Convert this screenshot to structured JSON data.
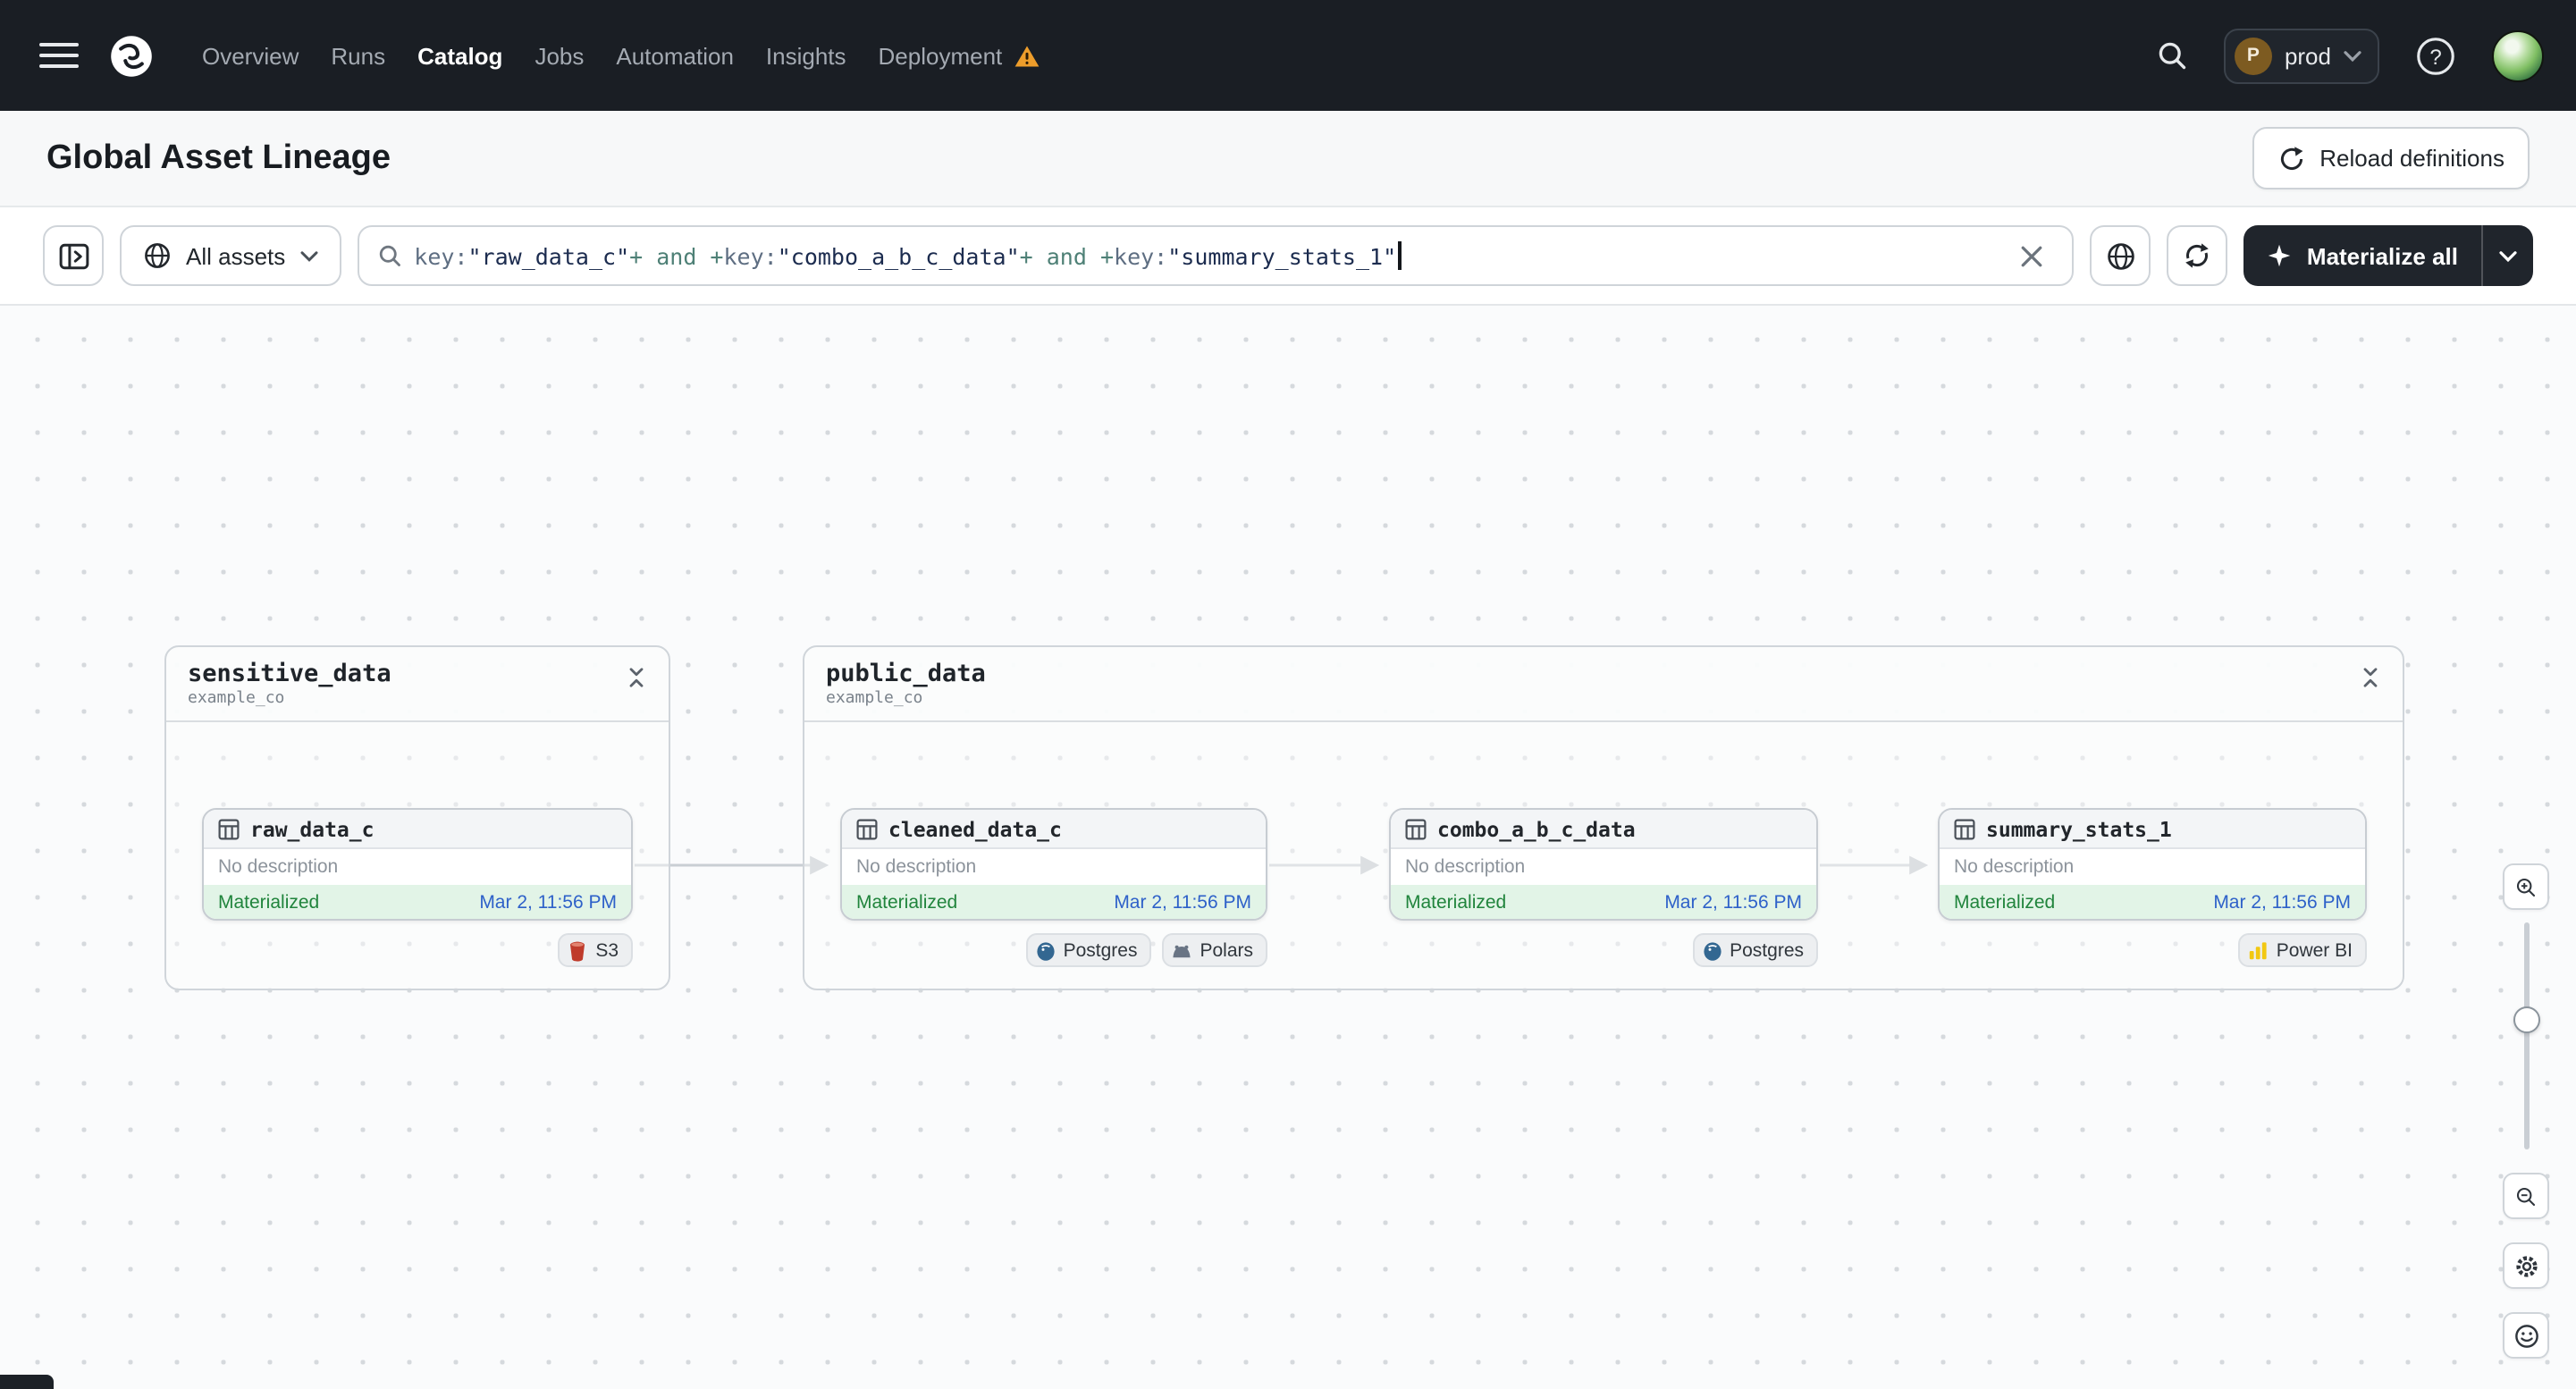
{
  "nav": {
    "items": [
      {
        "label": "Overview"
      },
      {
        "label": "Runs"
      },
      {
        "label": "Catalog"
      },
      {
        "label": "Jobs"
      },
      {
        "label": "Automation"
      },
      {
        "label": "Insights"
      },
      {
        "label": "Deployment"
      }
    ],
    "active_item": "Catalog",
    "deployment_switcher": {
      "avatar_letter": "P",
      "label": "prod"
    },
    "help_glyph": "?"
  },
  "header": {
    "title": "Global Asset Lineage",
    "reload_button_label": "Reload definitions"
  },
  "toolbar": {
    "scope_button_label": "All assets",
    "query_segments": [
      {
        "type": "key",
        "text": "key:"
      },
      {
        "type": "value",
        "text": "\"raw_data_c\""
      },
      {
        "type": "op",
        "text": "+ and +"
      },
      {
        "type": "key",
        "text": "key:"
      },
      {
        "type": "value",
        "text": "\"combo_a_b_c_data\""
      },
      {
        "type": "op",
        "text": "+ and +"
      },
      {
        "type": "key",
        "text": "key:"
      },
      {
        "type": "value",
        "text": "\"summary_stats_1\""
      }
    ],
    "materialize_button_label": "Materialize all"
  },
  "lineage": {
    "groups": [
      {
        "name": "sensitive_data",
        "location": "example_co",
        "assets": [
          {
            "name": "raw_data_c",
            "description": "No description",
            "status": "Materialized",
            "materialized_at": "Mar 2, 11:56 PM",
            "tags": [
              {
                "label": "S3"
              }
            ]
          }
        ]
      },
      {
        "name": "public_data",
        "location": "example_co",
        "assets": [
          {
            "name": "cleaned_data_c",
            "description": "No description",
            "status": "Materialized",
            "materialized_at": "Mar 2, 11:56 PM",
            "tags": [
              {
                "label": "Postgres"
              },
              {
                "label": "Polars"
              }
            ]
          },
          {
            "name": "combo_a_b_c_data",
            "description": "No description",
            "status": "Materialized",
            "materialized_at": "Mar 2, 11:56 PM",
            "tags": [
              {
                "label": "Postgres"
              }
            ]
          },
          {
            "name": "summary_stats_1",
            "description": "No description",
            "status": "Materialized",
            "materialized_at": "Mar 2, 11:56 PM",
            "tags": [
              {
                "label": "Power BI"
              }
            ]
          }
        ]
      }
    ]
  },
  "colors": {
    "nav_bg": "#1A1E24",
    "warning": "#ED9D2B",
    "materialized_bg": "#E2F4E7",
    "materialized_text": "#20843C",
    "timestamp_link": "#2E61C9",
    "query_key": "#5E6E82",
    "query_value": "#1C2C4F",
    "query_op": "#4E8076",
    "s3": "#BF3B2B",
    "postgres": "#336791",
    "power_bi": "#F2C811"
  }
}
